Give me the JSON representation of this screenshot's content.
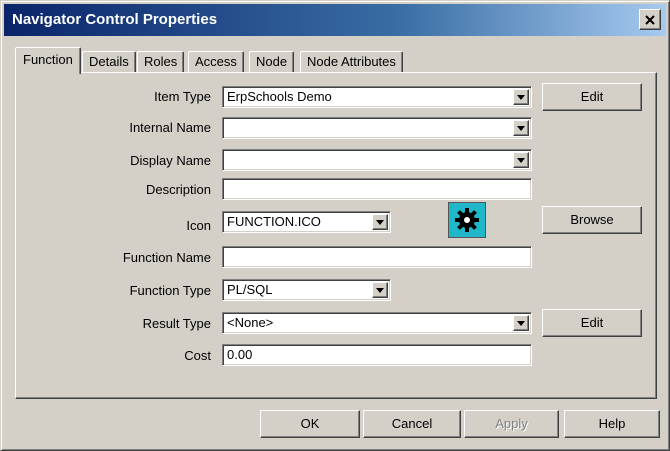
{
  "window": {
    "title": "Navigator Control Properties"
  },
  "tabs": [
    {
      "label": "Function",
      "active": true
    },
    {
      "label": "Details"
    },
    {
      "label": "Roles"
    },
    {
      "label": "Access"
    },
    {
      "label": "Node"
    },
    {
      "label": "Node Attributes"
    }
  ],
  "form": {
    "item_type": {
      "label": "Item Type",
      "value": "ErpSchools Demo"
    },
    "internal_name": {
      "label": "Internal Name",
      "value": ""
    },
    "display_name": {
      "label": "Display Name",
      "value": ""
    },
    "description": {
      "label": "Description",
      "value": ""
    },
    "icon": {
      "label": "Icon",
      "value": "FUNCTION.ICO"
    },
    "function_name": {
      "label": "Function Name",
      "value": ""
    },
    "function_type": {
      "label": "Function Type",
      "value": "PL/SQL"
    },
    "result_type": {
      "label": "Result Type",
      "value": "<None>"
    },
    "cost": {
      "label": "Cost",
      "value": "0.00"
    }
  },
  "side_buttons": {
    "edit_item_type": "Edit",
    "browse_icon": "Browse",
    "edit_result_type": "Edit"
  },
  "footer_buttons": {
    "ok": "OK",
    "cancel": "Cancel",
    "apply": "Apply",
    "help": "Help"
  },
  "icons": {
    "close": "close-icon",
    "dropdown": "chevron-down-icon",
    "icon_preview": "gear-icon"
  },
  "colors": {
    "titlebar_start": "#0a246a",
    "titlebar_end": "#a6caf0",
    "dialog_bg": "#d4d0c8",
    "icon_preview_bg": "#20b8c8"
  }
}
